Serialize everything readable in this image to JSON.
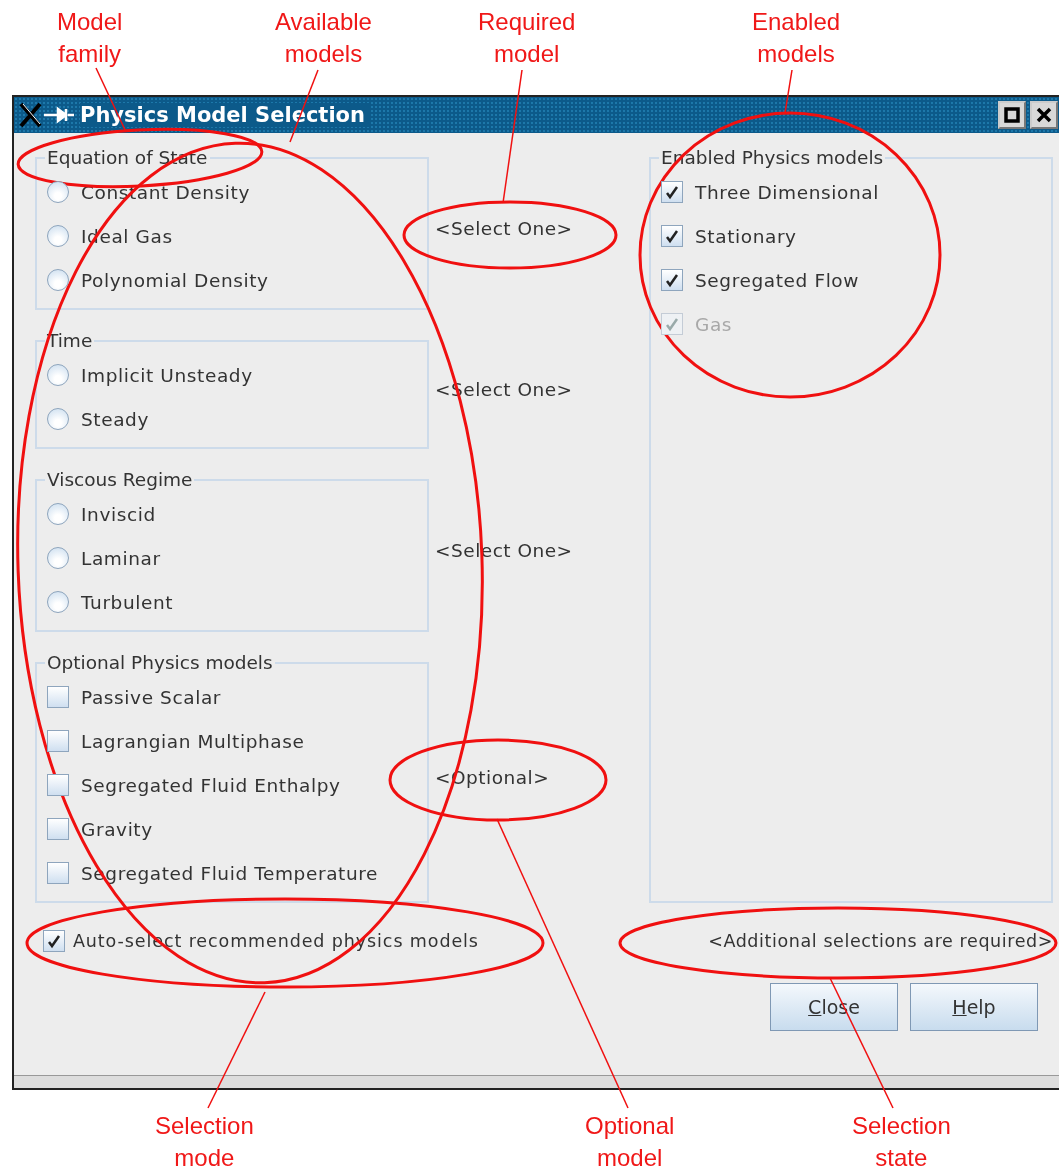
{
  "annotations": [
    {
      "text": "Model\nfamily"
    },
    {
      "text": "Available\nmodels"
    },
    {
      "text": "Required\nmodel"
    },
    {
      "text": "Enabled\nmodels"
    },
    {
      "text": "Selection\nmode"
    },
    {
      "text": "Optional\nmodel"
    },
    {
      "text": "Selection\nstate"
    }
  ],
  "window": {
    "title": "Physics Model Selection"
  },
  "groups": [
    {
      "legend": "Equation of State",
      "requirement": "<Select One>",
      "items": [
        {
          "label": "Constant Density",
          "kind": "radio",
          "selected": false
        },
        {
          "label": "Ideal Gas",
          "kind": "radio",
          "selected": false
        },
        {
          "label": "Polynomial Density",
          "kind": "radio",
          "selected": false
        }
      ]
    },
    {
      "legend": "Time",
      "requirement": "<Select One>",
      "items": [
        {
          "label": "Implicit Unsteady",
          "kind": "radio",
          "selected": false
        },
        {
          "label": "Steady",
          "kind": "radio",
          "selected": false
        }
      ]
    },
    {
      "legend": "Viscous Regime",
      "requirement": "<Select One>",
      "items": [
        {
          "label": "Inviscid",
          "kind": "radio",
          "selected": false
        },
        {
          "label": "Laminar",
          "kind": "radio",
          "selected": false
        },
        {
          "label": "Turbulent",
          "kind": "radio",
          "selected": false
        }
      ]
    },
    {
      "legend": "Optional Physics models",
      "requirement": "<Optional>",
      "items": [
        {
          "label": "Passive Scalar",
          "kind": "checkbox",
          "checked": false
        },
        {
          "label": "Lagrangian Multiphase",
          "kind": "checkbox",
          "checked": false
        },
        {
          "label": "Segregated Fluid Enthalpy",
          "kind": "checkbox",
          "checked": false
        },
        {
          "label": "Gravity",
          "kind": "checkbox",
          "checked": false
        },
        {
          "label": "Segregated Fluid Temperature",
          "kind": "checkbox",
          "checked": false
        }
      ]
    }
  ],
  "enabled": {
    "legend": "Enabled Physics models",
    "items": [
      {
        "label": "Three Dimensional",
        "checked": true,
        "disabled": false
      },
      {
        "label": "Stationary",
        "checked": true,
        "disabled": false
      },
      {
        "label": "Segregated Flow",
        "checked": true,
        "disabled": false
      },
      {
        "label": "Gas",
        "checked": true,
        "disabled": true
      }
    ]
  },
  "auto_select": {
    "label": "Auto-select recommended physics models",
    "checked": true
  },
  "status": "<Additional selections are required>",
  "buttons": [
    {
      "label": "Close"
    },
    {
      "label": "Help"
    }
  ]
}
